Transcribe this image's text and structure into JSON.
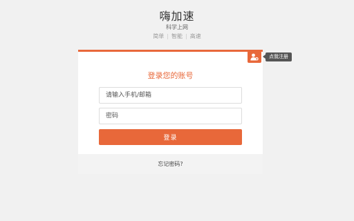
{
  "brand": {
    "title": "嗨加速",
    "subtitle": "科学上网",
    "tags": [
      "简单",
      "智能",
      "高速"
    ]
  },
  "login": {
    "title": "登录您的账号",
    "phone_placeholder": "请输入手机/邮箱",
    "password_placeholder": "密码",
    "submit_label": "登录",
    "forgot_label": "忘记密码?"
  },
  "register": {
    "icon": "add-user-icon",
    "tooltip": "点我注册"
  },
  "colors": {
    "accent": "#e8683a",
    "background": "#f1f1f1",
    "tooltip_bg": "#555555"
  }
}
